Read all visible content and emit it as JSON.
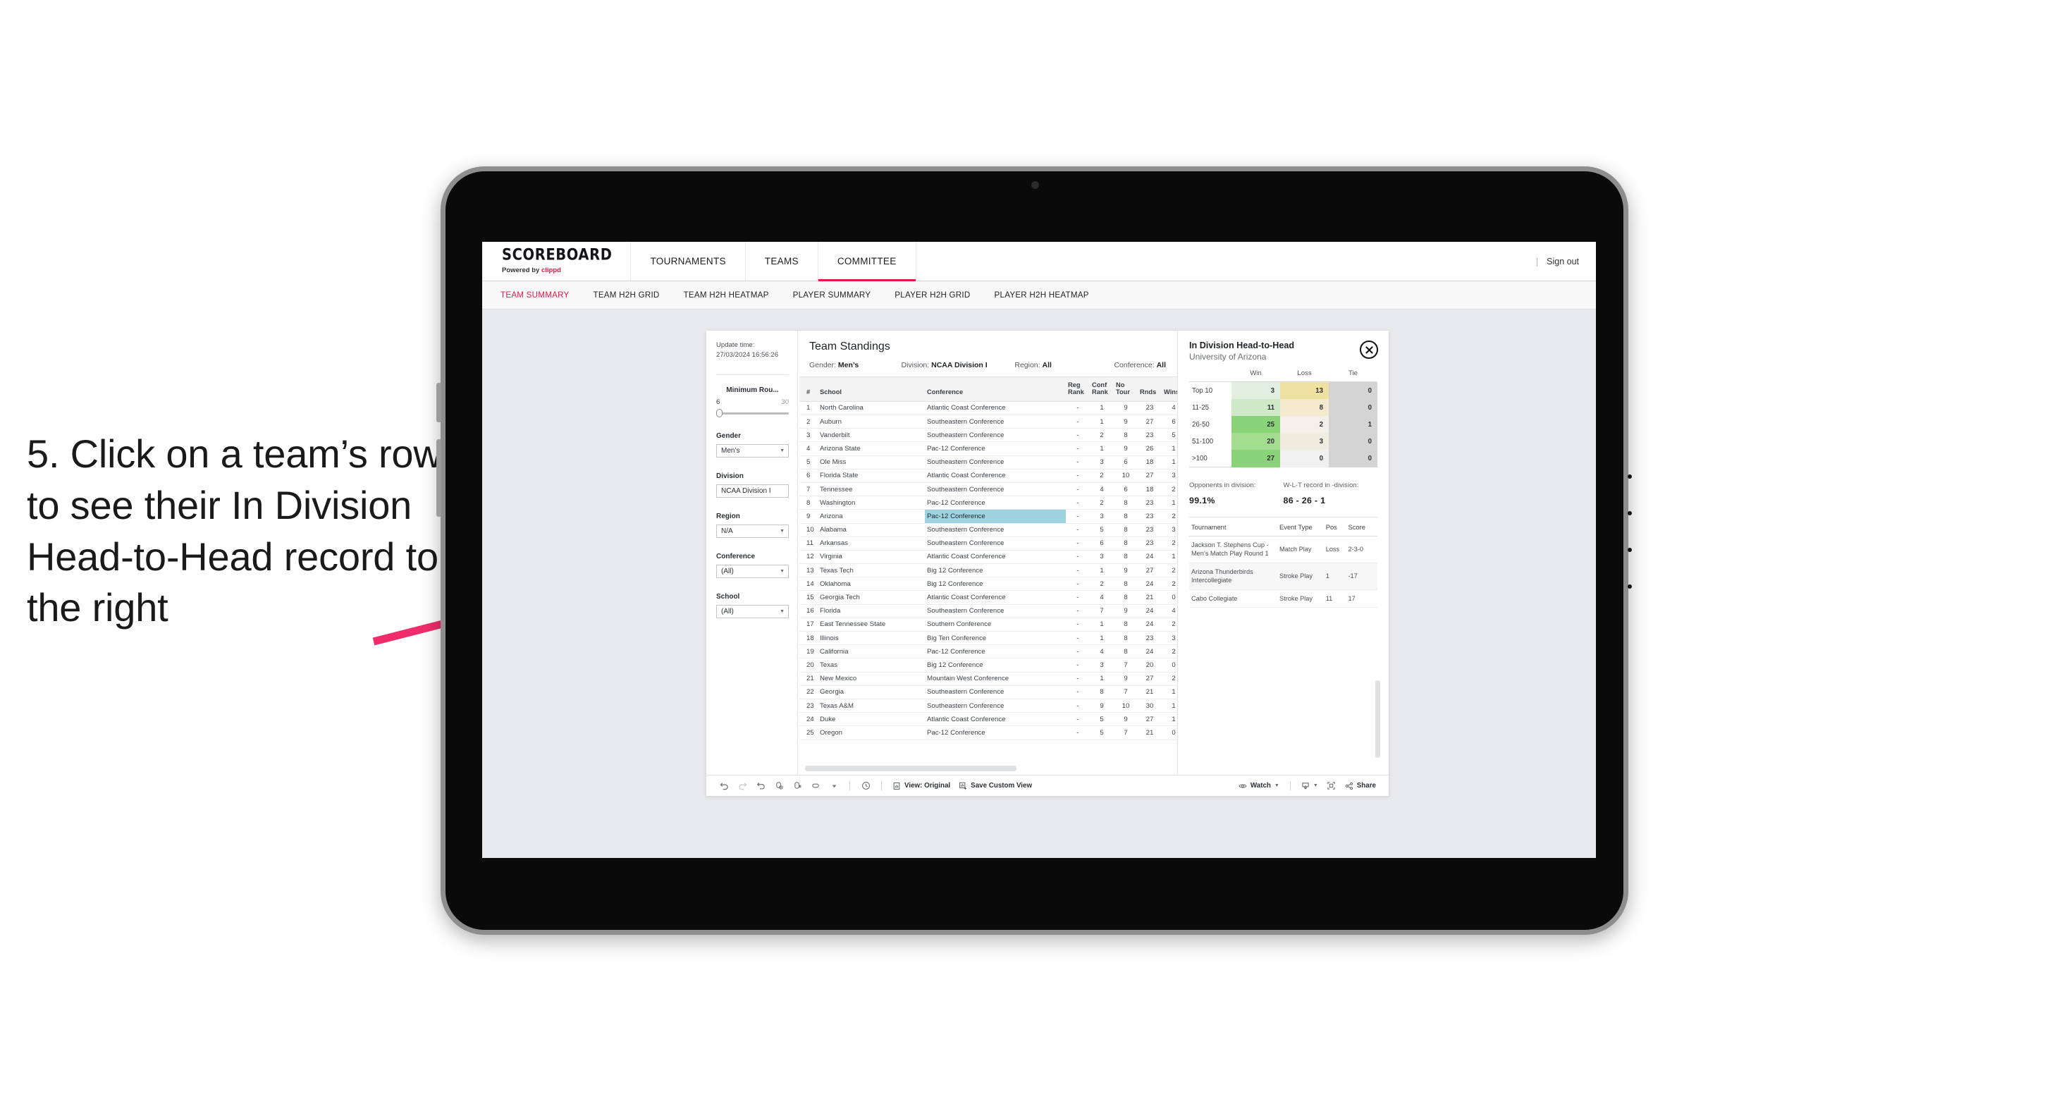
{
  "annotation": {
    "text": "5. Click on a team’s row to see their In Division Head-to-Head record to the right",
    "arrow_color": "#ef2d6b"
  },
  "header": {
    "brand_title": "SCOREBOARD",
    "brand_sub_prefix": "Powered by ",
    "brand_sub_name": "clippd",
    "nav": [
      {
        "label": "TOURNAMENTS",
        "active": false
      },
      {
        "label": "TEAMS",
        "active": false
      },
      {
        "label": "COMMITTEE",
        "active": true
      }
    ],
    "divider": "|",
    "sign_out": "Sign out",
    "accent_color": "#e8174a"
  },
  "subtabs": [
    {
      "label": "TEAM SUMMARY",
      "active": true
    },
    {
      "label": "TEAM H2H GRID",
      "active": false
    },
    {
      "label": "TEAM H2H HEATMAP",
      "active": false
    },
    {
      "label": "PLAYER SUMMARY",
      "active": false
    },
    {
      "label": "PLAYER H2H GRID",
      "active": false
    },
    {
      "label": "PLAYER H2H HEATMAP",
      "active": false
    }
  ],
  "filters": {
    "update_label": "Update time:",
    "update_value": "27/03/2024 16:56:26",
    "min_rounds": {
      "label": "Minimum Rou...",
      "min": "6",
      "max": "30"
    },
    "gender": {
      "label": "Gender",
      "value": "Men’s"
    },
    "division": {
      "label": "Division",
      "value": "NCAA Division I"
    },
    "region": {
      "label": "Region",
      "value": "N/A"
    },
    "conference": {
      "label": "Conference",
      "value": "(All)"
    },
    "school": {
      "label": "School",
      "value": "(All)"
    }
  },
  "standings": {
    "title": "Team Standings",
    "meta": {
      "gender_label": "Gender:",
      "gender_value": "Men’s",
      "division_label": "Division:",
      "division_value": "NCAA Division I",
      "region_label": "Region:",
      "region_value": "All",
      "conference_label": "Conference:",
      "conference_value": "All"
    },
    "columns": [
      "#",
      "School",
      "Conference",
      "Reg Rank",
      "Conf Rank",
      "No Tour",
      "Rnds",
      "Wins"
    ],
    "selected_row": 9,
    "rows": [
      {
        "n": "1",
        "school": "North Carolina",
        "conf": "Atlantic Coast Conference",
        "reg": "-",
        "confrank": "1",
        "notour": "9",
        "rnds": "23",
        "wins": "4"
      },
      {
        "n": "2",
        "school": "Auburn",
        "conf": "Southeastern Conference",
        "reg": "-",
        "confrank": "1",
        "notour": "9",
        "rnds": "27",
        "wins": "6"
      },
      {
        "n": "3",
        "school": "Vanderbilt",
        "conf": "Southeastern Conference",
        "reg": "-",
        "confrank": "2",
        "notour": "8",
        "rnds": "23",
        "wins": "5"
      },
      {
        "n": "4",
        "school": "Arizona State",
        "conf": "Pac-12 Conference",
        "reg": "-",
        "confrank": "1",
        "notour": "9",
        "rnds": "26",
        "wins": "1"
      },
      {
        "n": "5",
        "school": "Ole Miss",
        "conf": "Southeastern Conference",
        "reg": "-",
        "confrank": "3",
        "notour": "6",
        "rnds": "18",
        "wins": "1"
      },
      {
        "n": "6",
        "school": "Florida State",
        "conf": "Atlantic Coast Conference",
        "reg": "-",
        "confrank": "2",
        "notour": "10",
        "rnds": "27",
        "wins": "3"
      },
      {
        "n": "7",
        "school": "Tennessee",
        "conf": "Southeastern Conference",
        "reg": "-",
        "confrank": "4",
        "notour": "6",
        "rnds": "18",
        "wins": "2"
      },
      {
        "n": "8",
        "school": "Washington",
        "conf": "Pac-12 Conference",
        "reg": "-",
        "confrank": "2",
        "notour": "8",
        "rnds": "23",
        "wins": "1"
      },
      {
        "n": "9",
        "school": "Arizona",
        "conf": "Pac-12 Conference",
        "reg": "-",
        "confrank": "3",
        "notour": "8",
        "rnds": "23",
        "wins": "2"
      },
      {
        "n": "10",
        "school": "Alabama",
        "conf": "Southeastern Conference",
        "reg": "-",
        "confrank": "5",
        "notour": "8",
        "rnds": "23",
        "wins": "3"
      },
      {
        "n": "11",
        "school": "Arkansas",
        "conf": "Southeastern Conference",
        "reg": "-",
        "confrank": "6",
        "notour": "8",
        "rnds": "23",
        "wins": "2"
      },
      {
        "n": "12",
        "school": "Virginia",
        "conf": "Atlantic Coast Conference",
        "reg": "-",
        "confrank": "3",
        "notour": "8",
        "rnds": "24",
        "wins": "1"
      },
      {
        "n": "13",
        "school": "Texas Tech",
        "conf": "Big 12 Conference",
        "reg": "-",
        "confrank": "1",
        "notour": "9",
        "rnds": "27",
        "wins": "2"
      },
      {
        "n": "14",
        "school": "Oklahoma",
        "conf": "Big 12 Conference",
        "reg": "-",
        "confrank": "2",
        "notour": "8",
        "rnds": "24",
        "wins": "2"
      },
      {
        "n": "15",
        "school": "Georgia Tech",
        "conf": "Atlantic Coast Conference",
        "reg": "-",
        "confrank": "4",
        "notour": "8",
        "rnds": "21",
        "wins": "0"
      },
      {
        "n": "16",
        "school": "Florida",
        "conf": "Southeastern Conference",
        "reg": "-",
        "confrank": "7",
        "notour": "9",
        "rnds": "24",
        "wins": "4"
      },
      {
        "n": "17",
        "school": "East Tennessee State",
        "conf": "Southern Conference",
        "reg": "-",
        "confrank": "1",
        "notour": "8",
        "rnds": "24",
        "wins": "2"
      },
      {
        "n": "18",
        "school": "Illinois",
        "conf": "Big Ten Conference",
        "reg": "-",
        "confrank": "1",
        "notour": "8",
        "rnds": "23",
        "wins": "3"
      },
      {
        "n": "19",
        "school": "California",
        "conf": "Pac-12 Conference",
        "reg": "-",
        "confrank": "4",
        "notour": "8",
        "rnds": "24",
        "wins": "2"
      },
      {
        "n": "20",
        "school": "Texas",
        "conf": "Big 12 Conference",
        "reg": "-",
        "confrank": "3",
        "notour": "7",
        "rnds": "20",
        "wins": "0"
      },
      {
        "n": "21",
        "school": "New Mexico",
        "conf": "Mountain West Conference",
        "reg": "-",
        "confrank": "1",
        "notour": "9",
        "rnds": "27",
        "wins": "2"
      },
      {
        "n": "22",
        "school": "Georgia",
        "conf": "Southeastern Conference",
        "reg": "-",
        "confrank": "8",
        "notour": "7",
        "rnds": "21",
        "wins": "1"
      },
      {
        "n": "23",
        "school": "Texas A&M",
        "conf": "Southeastern Conference",
        "reg": "-",
        "confrank": "9",
        "notour": "10",
        "rnds": "30",
        "wins": "1"
      },
      {
        "n": "24",
        "school": "Duke",
        "conf": "Atlantic Coast Conference",
        "reg": "-",
        "confrank": "5",
        "notour": "9",
        "rnds": "27",
        "wins": "1"
      },
      {
        "n": "25",
        "school": "Oregon",
        "conf": "Pac-12 Conference",
        "reg": "-",
        "confrank": "5",
        "notour": "7",
        "rnds": "21",
        "wins": "0"
      }
    ]
  },
  "h2h": {
    "title": "In Division Head-to-Head",
    "subtitle": "University of Arizona",
    "close_icon": "close-icon",
    "matrix": {
      "columns": [
        "Win",
        "Loss",
        "Tie"
      ],
      "rows": [
        {
          "label": "Top 10",
          "win": "3",
          "loss": "13",
          "tie": "0",
          "win_bg": "#e2efe0",
          "loss_bg": "#f0e0a2",
          "tie_bg": "#d4d4d4"
        },
        {
          "label": "11-25",
          "win": "11",
          "loss": "8",
          "tie": "0",
          "win_bg": "#cfe8c6",
          "loss_bg": "#f4ead0",
          "tie_bg": "#d4d4d4"
        },
        {
          "label": "26-50",
          "win": "25",
          "loss": "2",
          "tie": "1",
          "win_bg": "#8bd378",
          "loss_bg": "#f2f0e8",
          "tie_bg": "#d4d4d4"
        },
        {
          "label": "51-100",
          "win": "20",
          "loss": "3",
          "tie": "0",
          "win_bg": "#a5dd90",
          "loss_bg": "#efece0",
          "tie_bg": "#d4d4d4"
        },
        {
          "label": ">100",
          "win": "27",
          "loss": "0",
          "tie": "0",
          "win_bg": "#8bd378",
          "loss_bg": "#f0f0f0",
          "tie_bg": "#d4d4d4"
        }
      ]
    },
    "stats": [
      {
        "label": "Opponents in division:",
        "value": "99.1%"
      },
      {
        "label": "W-L-T record in -division:",
        "value": "86 - 26 - 1"
      }
    ],
    "tours": {
      "columns": [
        "Tournament",
        "Event Type",
        "Pos",
        "Score"
      ],
      "rows": [
        {
          "name": "Jackson T. Stephens Cup - Men’s Match Play Round 1",
          "type": "Match Play",
          "pos": "Loss",
          "score": "2-3-0"
        },
        {
          "name": "Arizona Thunderbirds Intercollegiate",
          "type": "Stroke Play",
          "pos": "1",
          "score": "-17"
        },
        {
          "name": "Cabo Collegiate",
          "type": "Stroke Play",
          "pos": "11",
          "score": "17"
        }
      ]
    }
  },
  "toolbar": {
    "icons": [
      "undo-icon",
      "redo-icon",
      "revert-icon",
      "refresh-icon",
      "pause-icon",
      "zoom-icon",
      "chevron-down-icon"
    ],
    "clock_icon": "clock-icon",
    "view_label": "View: Original",
    "save_label": "Save Custom View",
    "watch_label": "Watch",
    "share_label": "Share",
    "download_icon": "download-icon",
    "fullscreen_icon": "fullscreen-icon"
  }
}
